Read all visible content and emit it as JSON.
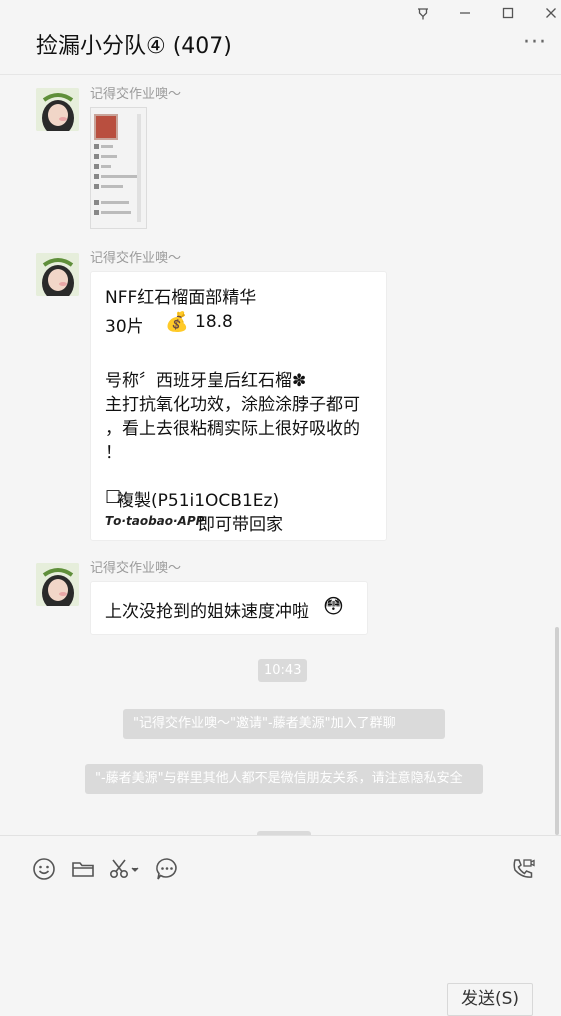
{
  "window": {
    "title": "捡漏小分队④ (407)",
    "more_label": "···",
    "controls": [
      "pin",
      "minimize",
      "maximize",
      "close"
    ]
  },
  "messages": [
    {
      "type": "image",
      "sender": "记得交作业噢～"
    },
    {
      "type": "text",
      "sender": "记得交作业噢～",
      "lines": [
        "NFF红石榴面部精华",
        "30片",
        "18.8",
        "号称〞西班牙皇后红石榴✽",
        "主打抗氧化功效，涂脸涂脖子都可",
        "，看上去很粘稠实际上很好吸收的",
        "！",
        "複製(P51i1OCB1Ez)",
        "𝙏𝙤·𝙩𝙖𝙤𝙗𝙖𝙤·𝘼𝙋𝙋",
        "即可带回家"
      ],
      "money_emoji": "💰",
      "box_glyph": "□"
    },
    {
      "type": "text",
      "sender": "记得交作业噢～",
      "text": "上次没抢到的姐妹速度冲啦",
      "emoji": "😳"
    }
  ],
  "timestamp": "10:43",
  "system_notices": [
    "\"记得交作业噢～\"邀请\"-藤者美源\"加入了群聊",
    "\"-藤者美源\"与群里其他人都不是微信朋友关系，请注意隐私安全"
  ],
  "toolbar": {
    "icons": [
      "emoji-icon",
      "folder-icon",
      "scissors-icon",
      "chat-bubble-icon",
      "video-call-icon"
    ]
  },
  "send_button": "发送(S)",
  "colors": {
    "bg": "#f5f5f5",
    "bubble": "#ffffff",
    "system": "#dadada",
    "sender": "#9a9a9a"
  }
}
